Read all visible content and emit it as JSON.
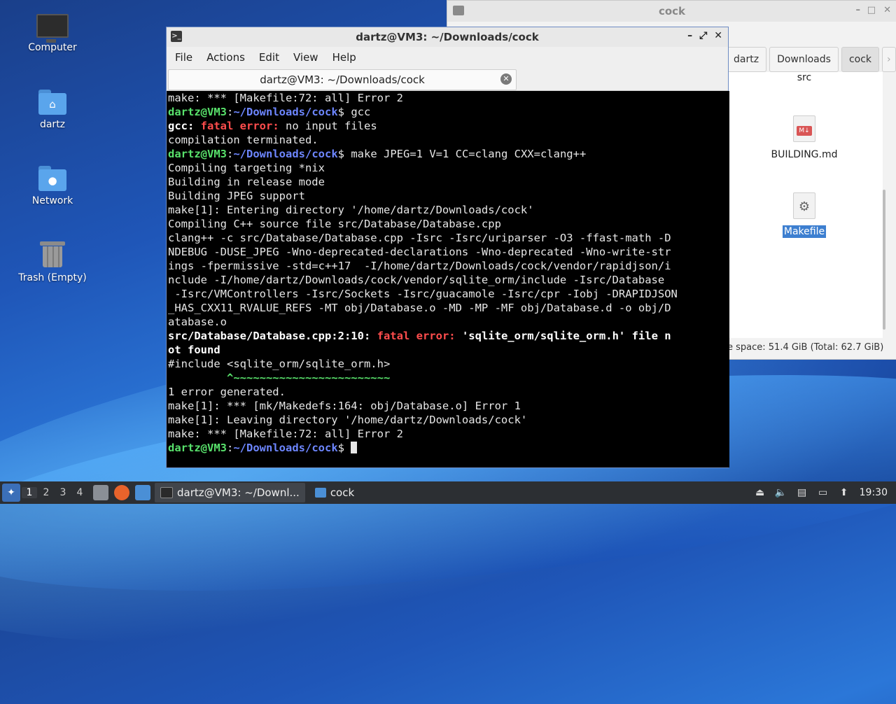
{
  "desktop": {
    "icons": [
      {
        "label": "Computer"
      },
      {
        "label": "dartz"
      },
      {
        "label": "Network"
      },
      {
        "label": "Trash (Empty)"
      }
    ]
  },
  "file_manager": {
    "title": "cock",
    "breadcrumbs": [
      "dartz",
      "Downloads",
      "cock"
    ],
    "files": [
      {
        "name": "src"
      },
      {
        "name": "BUILDING.md",
        "badge": "M↓"
      },
      {
        "name": "Makefile",
        "selected": true
      }
    ],
    "status": "e space: 51.4 GiB (Total: 62.7 GiB)"
  },
  "terminal": {
    "title": "dartz@VM3: ~/Downloads/cock",
    "tab_title": "dartz@VM3: ~/Downloads/cock",
    "menu": [
      "File",
      "Actions",
      "Edit",
      "View",
      "Help"
    ],
    "prompt_user": "dartz@VM3",
    "prompt_path": "~/Downloads/cock",
    "lines": {
      "l1": "make: *** [Makefile:72: all] Error 2",
      "l2_cmd": " gcc",
      "l3_a": "gcc: ",
      "l3_b": "fatal error: ",
      "l3_c": "no input files",
      "l4": "compilation terminated.",
      "l5_cmd": " make JPEG=1 V=1 CC=clang CXX=clang++",
      "l6": "Compiling targeting *nix",
      "l7": "Building in release mode",
      "l8": "Building JPEG support",
      "l9": "make[1]: Entering directory '/home/dartz/Downloads/cock'",
      "l10": "Compiling C++ source file src/Database/Database.cpp",
      "l11": "clang++ -c src/Database/Database.cpp -Isrc -Isrc/uriparser -O3 -ffast-math -D",
      "l12": "NDEBUG -DUSE_JPEG -Wno-deprecated-declarations -Wno-deprecated -Wno-write-str",
      "l13": "ings -fpermissive -std=c++17  -I/home/dartz/Downloads/cock/vendor/rapidjson/i",
      "l14": "nclude -I/home/dartz/Downloads/cock/vendor/sqlite_orm/include -Isrc/Database",
      "l15": " -Isrc/VMControllers -Isrc/Sockets -Isrc/guacamole -Isrc/cpr -Iobj -DRAPIDJSON",
      "l16": "_HAS_CXX11_RVALUE_REFS -MT obj/Database.o -MD -MP -MF obj/Database.d -o obj/D",
      "l17": "atabase.o",
      "l18_a": "src/Database/Database.cpp:2:10: ",
      "l18_b": "fatal error: ",
      "l18_c": "'sqlite_orm/sqlite_orm.h' file n",
      "l19": "ot found",
      "l20": "#include <sqlite_orm/sqlite_orm.h>",
      "l21": "         ^~~~~~~~~~~~~~~~~~~~~~~~~",
      "l22": "1 error generated.",
      "l23": "make[1]: *** [mk/Makedefs:164: obj/Database.o] Error 1",
      "l24": "make[1]: Leaving directory '/home/dartz/Downloads/cock'",
      "l25": "make: *** [Makefile:72: all] Error 2"
    }
  },
  "taskbar": {
    "workspaces": [
      "1",
      "2",
      "3",
      "4"
    ],
    "tasks": [
      {
        "label": "dartz@VM3: ~/Downl..."
      },
      {
        "label": "cock"
      }
    ],
    "clock": "19:30"
  }
}
